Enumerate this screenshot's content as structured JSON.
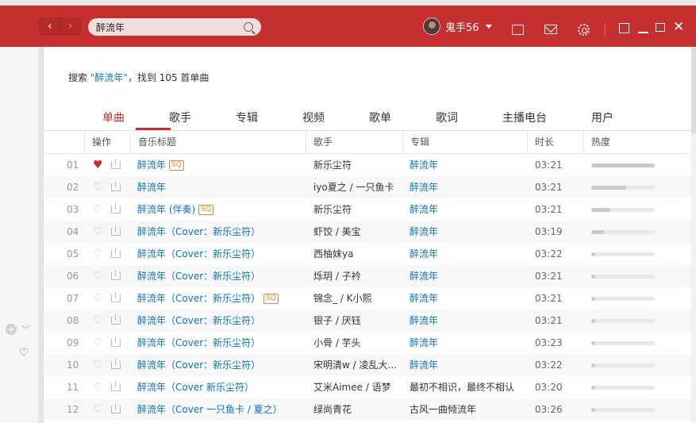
{
  "header": {
    "search_value": "醉流年",
    "user_name": "鬼手56",
    "back_glyph": "‹",
    "forward_glyph": "›",
    "close_glyph": "✕"
  },
  "summary": {
    "prefix": "搜索 ",
    "keyword": "\"醉流年\"",
    "suffix": "，找到 105 首单曲"
  },
  "tabs": [
    "单曲",
    "歌手",
    "专辑",
    "视频",
    "歌单",
    "歌词",
    "主播电台",
    "用户"
  ],
  "active_tab": 0,
  "columns": [
    "操作",
    "音乐标题",
    "歌手",
    "专辑",
    "时长",
    "热度"
  ],
  "sidebar": {
    "plus_glyph": "+",
    "chevron_glyph": "﹀",
    "heart_glyph": "♡"
  },
  "rows": [
    {
      "num": "01",
      "liked": true,
      "title": "醉流年",
      "tag": "SQ",
      "singer": "新乐尘符",
      "album": "醉流年",
      "album_link": true,
      "duration": "03:21",
      "heat": 1.0
    },
    {
      "num": "02",
      "liked": false,
      "title": "醉流年",
      "tag": "",
      "singer": "iyo夏之 / 一只鱼卡",
      "album": "醉流年",
      "album_link": true,
      "duration": "03:21",
      "heat": 0.55
    },
    {
      "num": "03",
      "liked": false,
      "title": "醉流年 (伴奏)",
      "tag": "SQ",
      "singer": "新乐尘符",
      "album": "醉流年",
      "album_link": true,
      "duration": "03:21",
      "heat": 0.3
    },
    {
      "num": "04",
      "liked": false,
      "title": "醉流年（Cover：新乐尘符）",
      "tag": "",
      "singer": "虾饺 / 美宝",
      "album": "醉流年",
      "album_link": true,
      "duration": "03:19",
      "heat": 0.2
    },
    {
      "num": "05",
      "liked": false,
      "title": "醉流年（Cover：新乐尘符）",
      "tag": "",
      "singer": "西柚妹ya",
      "album": "醉流年",
      "album_link": true,
      "duration": "03:22",
      "heat": 0.05
    },
    {
      "num": "06",
      "liked": false,
      "title": "醉流年（Cover：新乐尘符）",
      "tag": "",
      "singer": "烁玥 / 子衿",
      "album": "醉流年",
      "album_link": true,
      "duration": "03:21",
      "heat": 0.05
    },
    {
      "num": "07",
      "liked": false,
      "title": "醉流年（Cover：新乐尘符）",
      "tag": "SQ",
      "singer": "锦念_ / K小熙",
      "album": "醉流年",
      "album_link": true,
      "duration": "03:21",
      "heat": 0.05
    },
    {
      "num": "08",
      "liked": false,
      "title": "醉流年（Cover：新乐尘符）",
      "tag": "",
      "singer": "银子 / 厌钰",
      "album": "醉流年",
      "album_link": true,
      "duration": "03:21",
      "heat": 0.05
    },
    {
      "num": "09",
      "liked": false,
      "title": "醉流年（Cover：新乐尘符）",
      "tag": "",
      "singer": "小骨 / 芋头",
      "album": "醉流年",
      "album_link": true,
      "duration": "03:23",
      "heat": 0.05
    },
    {
      "num": "10",
      "liked": false,
      "title": "醉流年（Cover：新乐尘符）",
      "tag": "",
      "singer": "宋明清w / 凌乱大...",
      "album": "醉流年",
      "album_link": true,
      "duration": "03:22",
      "heat": 0.05
    },
    {
      "num": "11",
      "liked": false,
      "title": "醉流年（Cover 新乐尘符）",
      "tag": "",
      "singer": "艾米Aimee / 语梦",
      "album": "最初不相识，最终不相认",
      "album_link": false,
      "duration": "03:20",
      "heat": 0.05
    },
    {
      "num": "12",
      "liked": false,
      "title": "醉流年（Cover 一只鱼卡 / 夏之）",
      "tag": "",
      "singer": "绿尚青花",
      "album": "古风一曲倾流年",
      "album_link": false,
      "duration": "03:26",
      "heat": 0.05
    }
  ]
}
